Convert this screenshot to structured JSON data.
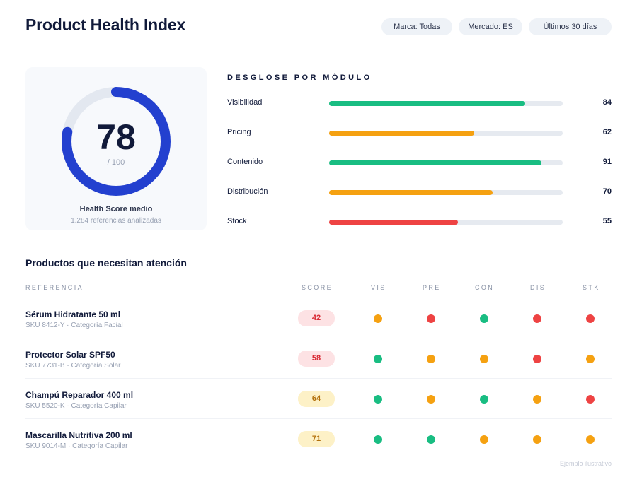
{
  "header": {
    "title": "Product Health Index",
    "filters": [
      "Marca: Todas",
      "Mercado: ES",
      "Últimos 30 días"
    ]
  },
  "score_card": {
    "value": "78",
    "scale": "/ 100",
    "fraction": 0.78,
    "label": "Health Score medio",
    "sub": "1.284 referencias analizadas"
  },
  "breakdown": {
    "title": "DESGLOSE POR MÓDULO",
    "modules": [
      {
        "label": "Visibilidad",
        "value": 84,
        "color": "#19bd82"
      },
      {
        "label": "Pricing",
        "value": 62,
        "color": "#f5a111"
      },
      {
        "label": "Contenido",
        "value": 91,
        "color": "#19bd82"
      },
      {
        "label": "Distribución",
        "value": 70,
        "color": "#f5a111"
      },
      {
        "label": "Stock",
        "value": 55,
        "color": "#ee4343"
      }
    ]
  },
  "attention": {
    "title": "Productos que necesitan atención",
    "columns": [
      "REFERENCIA",
      "SCORE",
      "VIS",
      "PRE",
      "CON",
      "DIS",
      "STK"
    ],
    "rows": [
      {
        "name": "Sérum Hidratante 50 ml",
        "meta": "SKU 8412-Y · Categoría Facial",
        "score": "42",
        "level": "bad",
        "dots": [
          "warn",
          "bad",
          "good",
          "bad",
          "bad"
        ]
      },
      {
        "name": "Protector Solar SPF50",
        "meta": "SKU 7731-B · Categoría Solar",
        "score": "58",
        "level": "bad",
        "dots": [
          "good",
          "warn",
          "warn",
          "bad",
          "warn"
        ]
      },
      {
        "name": "Champú Reparador 400 ml",
        "meta": "SKU 5520-K · Categoría Capilar",
        "score": "64",
        "level": "warn",
        "dots": [
          "good",
          "warn",
          "good",
          "warn",
          "bad"
        ]
      },
      {
        "name": "Mascarilla Nutritiva 200 ml",
        "meta": "SKU 9014-M · Categoría Capilar",
        "score": "71",
        "level": "warn",
        "dots": [
          "good",
          "good",
          "warn",
          "warn",
          "warn"
        ]
      }
    ]
  },
  "colors": {
    "accent": "#2340cf",
    "good": "#19bd82",
    "warn": "#f5a111",
    "bad": "#ee4343",
    "pill_bad_bg": "#fde2e4",
    "pill_bad_fg": "#d92b35",
    "pill_warn_bg": "#fdf1c7",
    "pill_warn_fg": "#b3700b"
  },
  "footnote": "Ejemplo ilustrativo"
}
